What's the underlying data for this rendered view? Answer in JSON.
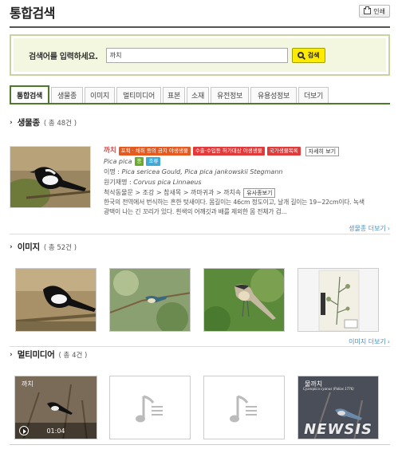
{
  "header": {
    "title": "통합검색",
    "print_label": "인쇄"
  },
  "search": {
    "label": "검색어를 입력하세요.",
    "value": "까치",
    "button_label": "검색"
  },
  "tabs": [
    {
      "label": "통합검색",
      "active": true
    },
    {
      "label": "생물종"
    },
    {
      "label": "이미지"
    },
    {
      "label": "멀티미디어"
    },
    {
      "label": "표본"
    },
    {
      "label": "소재"
    },
    {
      "label": "유전정보"
    },
    {
      "label": "유용성정보"
    },
    {
      "label": "더보기"
    }
  ],
  "species_section": {
    "title": "생물종",
    "count": "( 총 48건 )",
    "item": {
      "name": "까치",
      "tags": [
        "포획 · 채취 등의 금지 야생생물",
        "수출·수입등 허가대상 야생생물",
        "국가생물목록"
      ],
      "detail_button": "자세히 보기",
      "scientific_name": "Pica pica",
      "badges": [
        "종",
        "조류"
      ],
      "synonym_label": "이명 :",
      "synonym_value": "Pica sericea Gould, Pica pica jankowskii Stegmann",
      "original_label": "원기재명 :",
      "original_value": "Corvus pica Linnaeus",
      "taxonomy": "척삭동물문 > 조강 > 참새목 > 까마귀과 > 까치속",
      "similar_button": "유사종보기",
      "description_1": "한국의 전역에서 번식하는 흔한 텃새이다. 몸길이는 46cm 정도이고, 날개 길이는 19~22cm이다. 녹색",
      "description_2": "광택이 나는 긴 꼬리가 있다. 흰색의 어깨깃과 배를 제외한 몸 전체가 검..."
    },
    "more_link": "생물종 더보기"
  },
  "image_section": {
    "title": "이미지",
    "count": "( 총 52건 )",
    "more_link": "이미지 더보기"
  },
  "multimedia_section": {
    "title": "멀티미디어",
    "count": "( 총 4건 )",
    "items": [
      {
        "caption": "까치",
        "duration": "01:04"
      },
      {
        "caption": ""
      },
      {
        "caption": ""
      },
      {
        "caption": "물까치",
        "subtitle": "Cyanopica cyanus (Pallas 1776)"
      }
    ]
  },
  "watermark": "NEWSIS"
}
